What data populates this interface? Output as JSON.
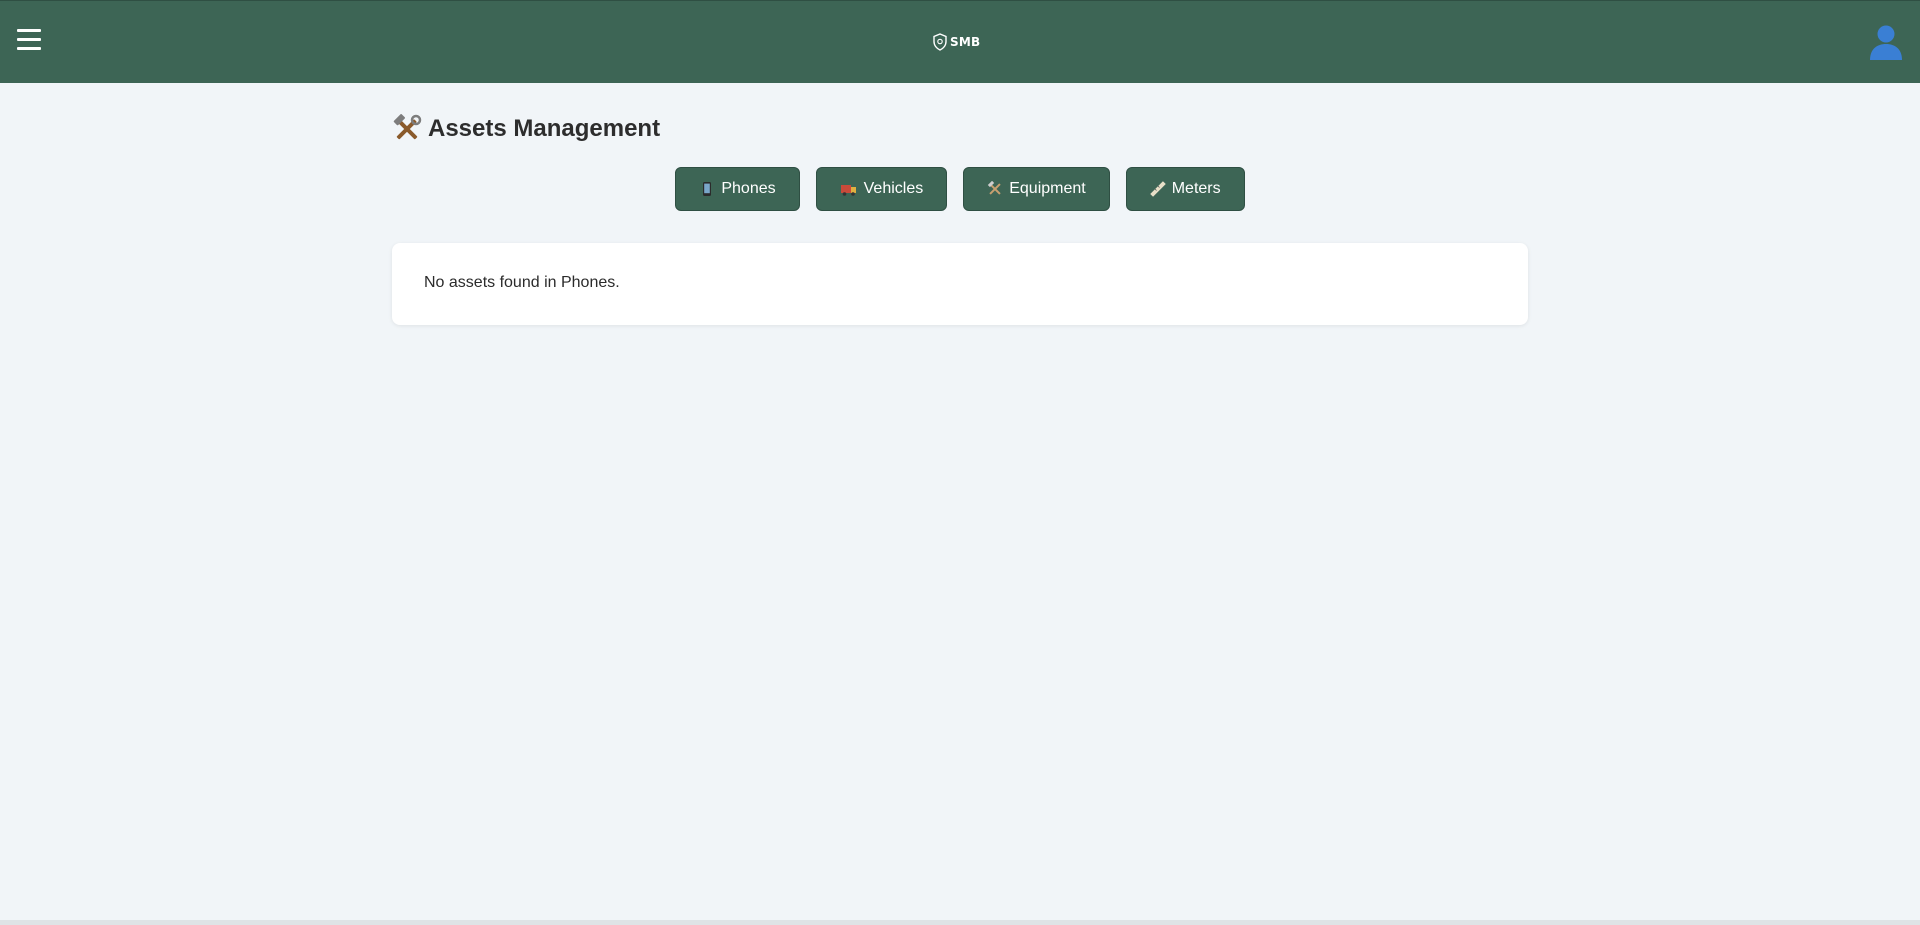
{
  "header": {
    "logo_text": "SMB",
    "brand_color": "#3d6555",
    "menu_icon": "hamburger-icon",
    "user_icon": "user-icon"
  },
  "main": {
    "title": "Assets Management",
    "title_icon": "tools-icon",
    "tabs": [
      {
        "label": "Phones",
        "icon": "phone-icon"
      },
      {
        "label": "Vehicles",
        "icon": "truck-icon"
      },
      {
        "label": "Equipment",
        "icon": "tools-icon"
      },
      {
        "label": "Meters",
        "icon": "ruler-icon"
      }
    ],
    "empty_message": "No assets found in Phones."
  }
}
